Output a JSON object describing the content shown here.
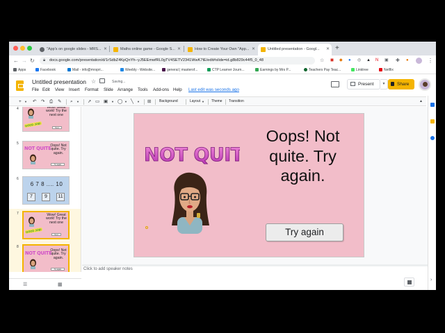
{
  "browser": {
    "tabs": [
      {
        "title": "\"App's on google slides - MRS..."
      },
      {
        "title": "Maths online game - Google S..."
      },
      {
        "title": "How to Create Your Own \"App..."
      },
      {
        "title": "Untitled presentation - Googl..."
      }
    ],
    "new_tab": "+",
    "url": "docs.google.com/presentation/d/1rSdbZ4KpQnYh--yJ5EEmwfRL0gTV4SETV2341WwK7tE/edit#slide=id.g8b829c44f5_0_48",
    "bookmarks": [
      {
        "label": "Apps",
        "color": "#5f6368"
      },
      {
        "label": "Facebook",
        "color": "#1877f2"
      },
      {
        "label": "Mail - info@mrspri...",
        "color": "#0078d4"
      },
      {
        "label": "Weebly - Website...",
        "color": "#1e88e5"
      },
      {
        "label": "general | masterof...",
        "color": "#4a154b"
      },
      {
        "label": "CTP Learner Journ...",
        "color": "#0f9d58"
      },
      {
        "label": "Earnings by Mrs P...",
        "color": "#34a853"
      },
      {
        "label": "Teachers Pay Teac...",
        "color": "#0d652d"
      },
      {
        "label": "Linktree",
        "color": "#43e660"
      },
      {
        "label": "Netflix",
        "color": "#e50914"
      }
    ]
  },
  "app": {
    "title": "Untitled presentation",
    "saving": "Saving...",
    "menu": [
      "File",
      "Edit",
      "View",
      "Insert",
      "Format",
      "Slide",
      "Arrange",
      "Tools",
      "Add-ons",
      "Help"
    ],
    "last_edit": "Last edit was seconds ago",
    "present": "Present",
    "share": "Share"
  },
  "toolbar": {
    "background": "Background",
    "layout": "Layout",
    "theme": "Theme",
    "transition": "Transition"
  },
  "filmstrip": [
    {
      "num": "4",
      "text": "Wow! Great work! Try the next one",
      "button": "Next",
      "badge": "GOOD JOB!"
    },
    {
      "num": "5",
      "text": "Oops! Not quite. Try again.",
      "button": "Try again",
      "title": "NOT QUITE"
    },
    {
      "num": "6",
      "seq": "6 7 8 .... 10",
      "boxes": [
        "7",
        "9",
        "11"
      ]
    },
    {
      "num": "7",
      "text": "Wow! Great work! Try the next one",
      "button": "Next",
      "badge": "GOOD JOB!"
    },
    {
      "num": "8",
      "text": "Oops! Not quite. Try again.",
      "button": "Try again",
      "title": "NOT QUITE"
    }
  ],
  "slide": {
    "title_art": "NOT QUITE",
    "text": "Oops! Not quite. Try again.",
    "button": "Try again",
    "background": "#f2bdc9"
  },
  "notes": {
    "placeholder": "Click to add speaker notes"
  },
  "colors": {
    "accent": "#f4b400",
    "link": "#1a73e8",
    "not_quite": "#d04fc7"
  }
}
